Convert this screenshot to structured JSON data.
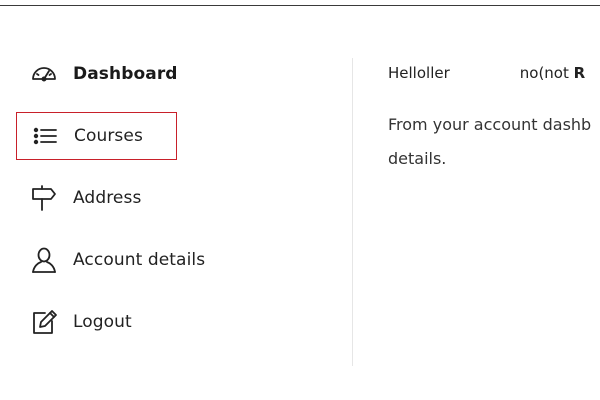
{
  "sidebar": {
    "items": [
      {
        "label": "Dashboard",
        "icon": "dashboard-gauge-icon",
        "active": true
      },
      {
        "label": "Courses",
        "icon": "list-icon",
        "highlighted": true
      },
      {
        "label": "Address",
        "icon": "signpost-icon"
      },
      {
        "label": "Account details",
        "icon": "user-icon"
      },
      {
        "label": "Logout",
        "icon": "edit-icon"
      }
    ]
  },
  "main": {
    "greeting_prefix": "Helloller",
    "greeting_suffix": "no(not",
    "greeting_bold": "R",
    "intro_line1": "From your account dashb",
    "intro_line2": "details."
  },
  "colors": {
    "highlight_border": "#c8202a",
    "text": "#222222",
    "divider": "#e6e6e6"
  }
}
